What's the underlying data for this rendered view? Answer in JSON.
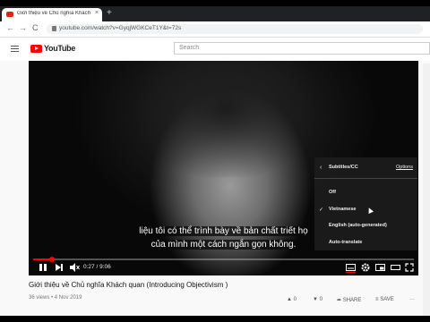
{
  "browser": {
    "tab_title": "Giới thiệu về Chủ nghĩa Khách qu",
    "tab_close": "×",
    "new_tab": "+",
    "url": "youtube.com/watch?v=GyqjWGKCeT1Y&t=72s",
    "nav": {
      "back": "←",
      "forward": "→",
      "reload": "C"
    }
  },
  "youtube": {
    "logo_text": "YouTube",
    "logo_suffix": "VN",
    "search_placeholder": "Search"
  },
  "player": {
    "subtitle_line1": "liệu tôi có thể trình bày về bản chất triết họ",
    "subtitle_line2": "của mình một cách ngắn gọn không.",
    "current_time": "0:27 / 9:06",
    "progress": 0.049,
    "settings_menu": {
      "back_arrow": "‹",
      "title": "Subtitles/CC",
      "options_link": "Options",
      "items": [
        {
          "label": "Off",
          "checked": false
        },
        {
          "label": "Vietnamese",
          "checked": true
        },
        {
          "label": "English (auto-generated)",
          "checked": false
        },
        {
          "label": "Auto-translate",
          "checked": false
        }
      ],
      "check_mark": "✓"
    },
    "accent_color": "#ff0000"
  },
  "video": {
    "title": "Giới thiệu về Chủ nghĩa Khách quan (Introducing Objectivism )",
    "meta": "36 views • 4 Nov 2019",
    "likes": "0",
    "dislikes": "0",
    "share_label": "SHARE",
    "save_label": "SAVE",
    "more": "···"
  }
}
